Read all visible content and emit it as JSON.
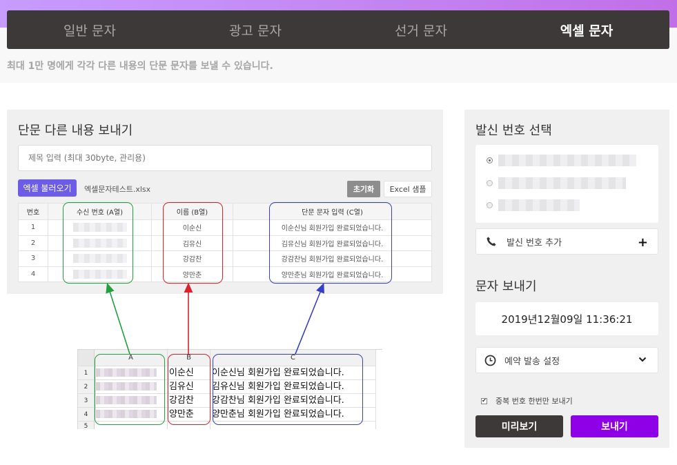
{
  "tabs": [
    {
      "label": "일반 문자",
      "active": false
    },
    {
      "label": "광고 문자",
      "active": false
    },
    {
      "label": "선거 문자",
      "active": false
    },
    {
      "label": "엑셀 문자",
      "active": true
    }
  ],
  "subtitle": "최대 1만 명에게 각각 다른 내용의 단문 문자를 보낼 수 있습니다.",
  "main": {
    "title": "단문 다른 내용 보내기",
    "title_input_placeholder": "제목 입력 (최대 30byte, 관리용)",
    "excel_button": "엑셀 불러오기",
    "file_name": "엑셀문자테스트.xlsx",
    "reset_button": "초기화",
    "sample_button": "Excel 샘플",
    "table": {
      "headers": [
        "번호",
        "수신 번호 (A열)",
        "이름 (B열)",
        "단문 문자 입력 (C열)"
      ],
      "rows": [
        {
          "no": "1",
          "name": "이순신",
          "message": "이순신님 회원가입 완료되었습니다."
        },
        {
          "no": "2",
          "name": "김유신",
          "message": "김유신님 회원가입 완료되었습니다."
        },
        {
          "no": "3",
          "name": "강감찬",
          "message": "강감찬님 회원가입 완료되었습니다."
        },
        {
          "no": "4",
          "name": "양만춘",
          "message": "양만춘님 회원가입 완료되었습니다."
        }
      ]
    }
  },
  "excel_sheet": {
    "columns": [
      "A",
      "B",
      "C"
    ],
    "rows": [
      {
        "num": "1",
        "b": "이순신",
        "c": "이순신님 회원가입 완료되었습니다."
      },
      {
        "num": "2",
        "b": "김유신",
        "c": "김유신님 회원가입 완료되었습니다."
      },
      {
        "num": "3",
        "b": "강감찬",
        "c": "강감찬님 회원가입 완료되었습니다."
      },
      {
        "num": "4",
        "b": "양만춘",
        "c": "양만춘님 회원가입 완료되었습니다."
      },
      {
        "num": "5",
        "b": "",
        "c": ""
      }
    ]
  },
  "sidebar": {
    "sender_title": "발신 번호 선택",
    "add_sender_label": "발신 번호 추가",
    "send_title": "문자 보내기",
    "datetime": "2019년12월09일 11:36:21",
    "schedule_label": "예약 발송 설정",
    "dedupe_label": "중복 번호 한번만 보내기",
    "preview_button": "미리보기",
    "send_button": "보내기"
  },
  "colors": {
    "accent_purple": "#8e00e6",
    "excel_button": "#6c5ce7",
    "dark": "#3d3939",
    "highlight_green": "#21a03e",
    "highlight_red": "#d8232a",
    "highlight_blue": "#3440c8"
  }
}
